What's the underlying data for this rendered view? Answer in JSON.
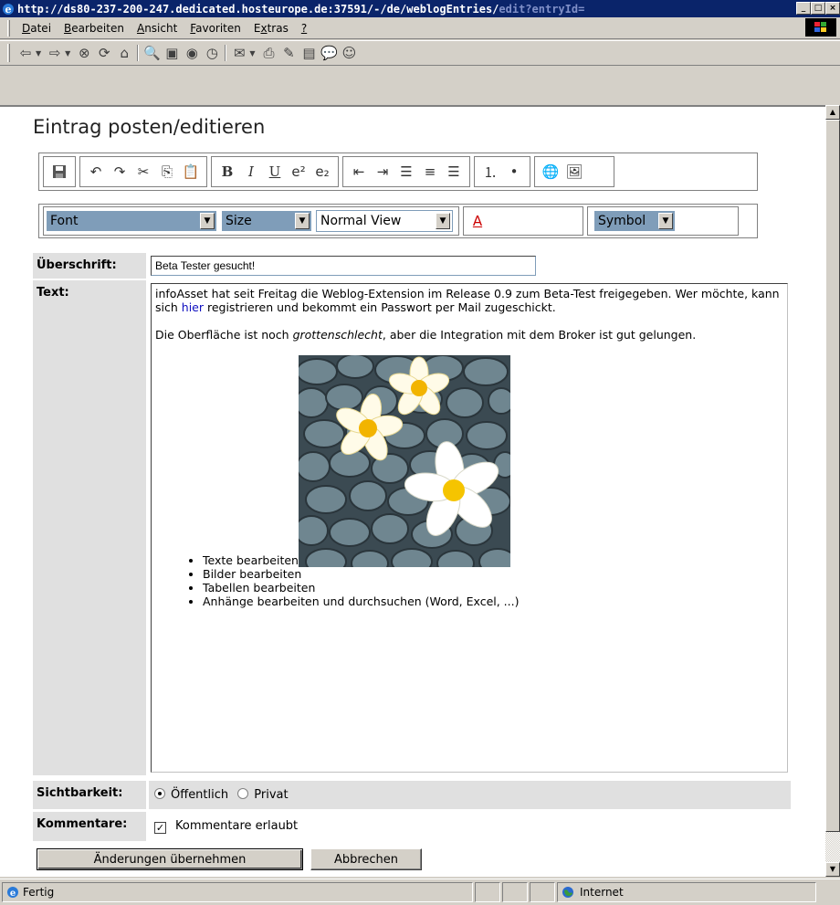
{
  "window": {
    "title_main": "http://ds80-237-200-247.dedicated.hosteurope.de:37591/-/de/weblogEntries/",
    "title_faded": "edit?entryId="
  },
  "menu": [
    "Datei",
    "Bearbeiten",
    "Ansicht",
    "Favoriten",
    "Extras",
    "?"
  ],
  "menu_underline": [
    "D",
    "B",
    "A",
    "F",
    "x",
    "?"
  ],
  "page": {
    "title": "Eintrag posten/editieren"
  },
  "editor": {
    "font_select": "Font",
    "size_select": "Size",
    "view_select": "Normal View",
    "symbol_select": "Symbol",
    "superscript_label": "e²",
    "subscript_label": "e₂"
  },
  "form": {
    "heading_label": "Überschrift:",
    "heading_value": "Beta Tester gesucht!",
    "text_label": "Text:",
    "text": {
      "p1_before": "infoAsset hat seit Freitag die Weblog-Extension im Release 0.9 zum Beta-Test freigegeben. Wer möchte, kann sich ",
      "p1_link": "hier",
      "p1_after": " registrieren und bekommt ein Passwort per Mail zugeschickt.",
      "p2_before": "Die Oberfläche ist noch ",
      "p2_italic": "grottenschlecht",
      "p2_after": ", aber die Integration mit dem Broker ist gut gelungen.",
      "bullets": [
        "Texte bearbeiten",
        "Bilder bearbeiten",
        "Tabellen bearbeiten",
        "Anhänge bearbeiten und durchsuchen (Word, Excel, ...)"
      ]
    },
    "visibility_label": "Sichtbarkeit:",
    "visibility_public": "Öffentlich",
    "visibility_private": "Privat",
    "visibility_selected": "public",
    "comments_label": "Kommentare:",
    "comments_option": "Kommentare erlaubt",
    "comments_checked": true
  },
  "buttons": {
    "apply": "Änderungen übernehmen",
    "cancel": "Abbrechen"
  },
  "status": {
    "left": "Fertig",
    "zone": "Internet"
  },
  "colors": {
    "titlebar": "#0a246a",
    "select_bg": "#7f9db9",
    "link": "#1010c0"
  }
}
